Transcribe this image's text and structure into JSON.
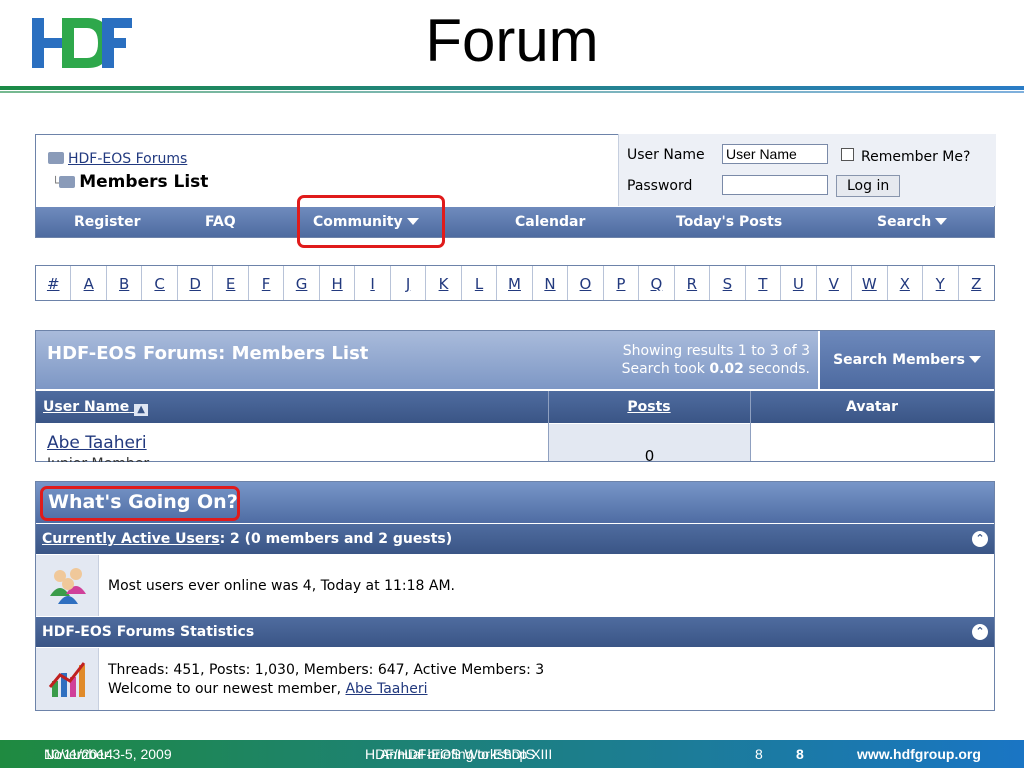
{
  "slide": {
    "title": "Forum",
    "logo_text": "HDF",
    "colors": {
      "logo_blue": "#2a6fc0",
      "logo_green": "#2ea84b",
      "bar_green": "#1f8a40",
      "bar_blue": "#1a75c4",
      "highlight": "#e01b1b"
    }
  },
  "breadcrumb": {
    "forum": "HDF-EOS Forums",
    "current": "Members List"
  },
  "login": {
    "username_label": "User Name",
    "username_value": "User Name",
    "password_label": "Password",
    "remember_label": "Remember Me?",
    "login_button": "Log in"
  },
  "menu": {
    "register": "Register",
    "faq": "FAQ",
    "community": "Community",
    "calendar": "Calendar",
    "todays_posts": "Today's Posts",
    "search": "Search"
  },
  "alphabet": [
    "#",
    "A",
    "B",
    "C",
    "D",
    "E",
    "F",
    "G",
    "H",
    "I",
    "J",
    "K",
    "L",
    "M",
    "N",
    "O",
    "P",
    "Q",
    "R",
    "S",
    "T",
    "U",
    "V",
    "W",
    "X",
    "Y",
    "Z"
  ],
  "members_list": {
    "title": "HDF-EOS Forums: Members List",
    "showing": "Showing results 1 to 3 of 3",
    "search_prefix": "Search took ",
    "search_time": "0.02",
    "search_suffix": " seconds.",
    "search_members": "Search Members",
    "columns": {
      "user_name": "User Name",
      "posts": "Posts",
      "avatar": "Avatar"
    },
    "rows": [
      {
        "user": "Abe Taaheri",
        "posts": "0",
        "subtitle": "Junior Member"
      }
    ]
  },
  "whats_going_on": {
    "title": "What's Going On?",
    "active_users_link": "Currently Active Users",
    "active_users_rest": ": 2 (0 members and 2 guests)",
    "most_online": "Most users ever online was 4, Today at 11:18 AM.",
    "stats_title": "HDF-EOS Forums Statistics",
    "stats_line": "Threads: 451, Posts: 1,030, Members: 647, Active Members: 3",
    "welcome_prefix": "Welcome to our newest member, ",
    "newest_member": "Abe Taaheri"
  },
  "footer": {
    "date_a": "10/11/2014",
    "date_b": "November 3-5, 2009",
    "event_a": "HDF/HDF-EOS Workshop XIII",
    "event_b": "Annual briefing to ESDIS",
    "page_a": "8",
    "page_b": "8",
    "url": "www.hdfgroup.org"
  }
}
